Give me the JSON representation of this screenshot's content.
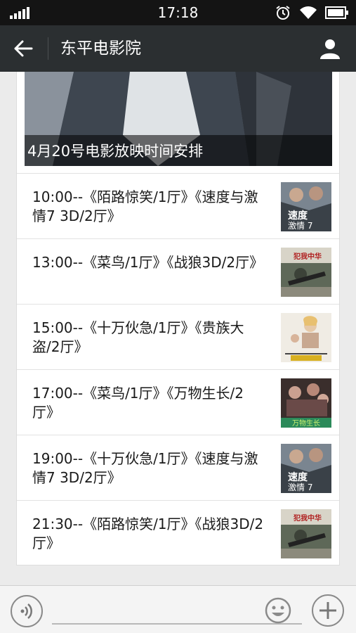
{
  "status_bar": {
    "time": "17:18"
  },
  "nav": {
    "title": "东平电影院"
  },
  "article": {
    "hero_caption": "4月20号电影放映时间安排"
  },
  "schedule": [
    {
      "text": "10:00--《陌路惊笑/1厅》《速度与激情7 3D/2厅》",
      "poster_icon": "fast-furious-poster"
    },
    {
      "text": "13:00--《菜鸟/1厅》《战狼3D/2厅》",
      "poster_icon": "wolf-warrior-poster"
    },
    {
      "text": "15:00--《十万伙急/1厅》《贵族大盗/2厅》",
      "poster_icon": "mortdecai-poster"
    },
    {
      "text": "17:00--《菜鸟/1厅》《万物生长/2厅》",
      "poster_icon": "wanwu-poster"
    },
    {
      "text": "19:00--《十万伙急/1厅》《速度与激情7 3D/2厅》",
      "poster_icon": "fast-furious-poster"
    },
    {
      "text": "21:30--《陌路惊笑/1厅》《战狼3D/2厅》",
      "poster_icon": "wolf-warrior-poster"
    }
  ],
  "icons": {
    "back": "back-arrow-icon",
    "user": "user-icon",
    "voice": "voice-icon",
    "emoji": "emoji-icon",
    "plus": "plus-icon"
  }
}
